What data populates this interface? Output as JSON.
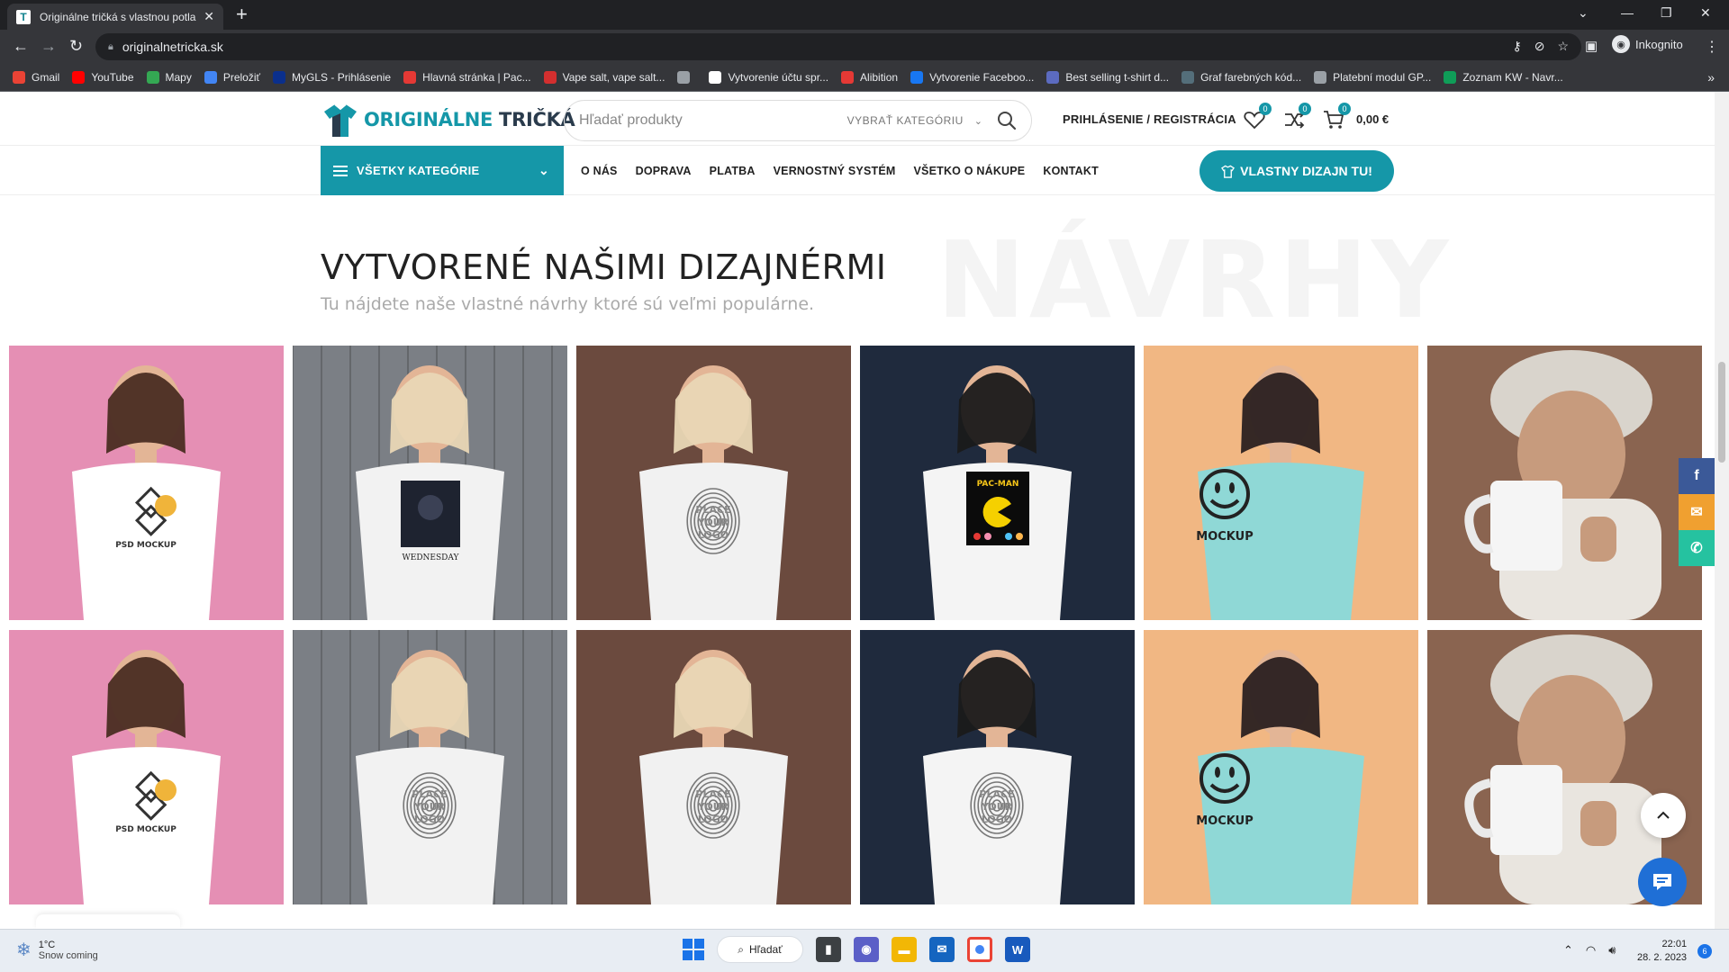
{
  "browser": {
    "tab_title": "Originálne tričká s vlastnou potla",
    "url": "originalnetricka.sk",
    "profile_label": "Inkognito",
    "bookmarks": [
      {
        "label": "Gmail",
        "color": "#ea4335"
      },
      {
        "label": "YouTube",
        "color": "#ff0000"
      },
      {
        "label": "Mapy",
        "color": "#34a853"
      },
      {
        "label": "Preložiť",
        "color": "#4285f4"
      },
      {
        "label": "MyGLS - Prihlásenie",
        "color": "#0a2f8c"
      },
      {
        "label": "Hlavná stránka | Pac...",
        "color": "#e53935"
      },
      {
        "label": "Vape salt, vape salt...",
        "color": "#d32f2f"
      },
      {
        "label": "",
        "color": "#9aa0a6"
      },
      {
        "label": "Vytvorenie účtu spr...",
        "color": "#ffffff"
      },
      {
        "label": "Alibition",
        "color": "#e53935"
      },
      {
        "label": "Vytvorenie Faceboo...",
        "color": "#1877f2"
      },
      {
        "label": "Best selling t-shirt d...",
        "color": "#5c6bc0"
      },
      {
        "label": "Graf farebných kód...",
        "color": "#546e7a"
      },
      {
        "label": "Platební modul GP...",
        "color": "#9aa0a6"
      },
      {
        "label": "Zoznam KW - Navr...",
        "color": "#0f9d58"
      }
    ]
  },
  "header": {
    "logo_part1": "ORIGINÁLNE",
    "logo_part2": "TRIČKÁ",
    "search_placeholder": "Hľadať produkty",
    "category_select": "VYBRAŤ KATEGÓRIU",
    "login": "PRIHLÁSENIE / REGISTRÁCIA",
    "wishlist_count": "0",
    "compare_count": "0",
    "cart_count": "0",
    "cart_total": "0,00 €"
  },
  "nav": {
    "all_categories": "VŠETKY KATEGÓRIE",
    "menu": [
      "O NÁS",
      "DOPRAVA",
      "PLATBA",
      "VERNOSTNÝ SYSTÉM",
      "VŠETKO O NÁKUPE",
      "KONTAKT"
    ],
    "cta": "VLASTNY DIZAJN TU!"
  },
  "section": {
    "watermark": "NÁVRHY",
    "title": "VYTVORENÉ NAŠIMI DIZAJNÉRMI",
    "subtitle": "Tu nájdete naše vlastné návrhy ktoré sú veľmi populárne."
  },
  "products": [
    {
      "bg": "#e58fb4",
      "shirt": "#ffffff",
      "print": "PSD MOCKUP",
      "kind": "logo"
    },
    {
      "bg": "#7b7f85",
      "shirt": "#f2f2f2",
      "print": "WEDNESDAY",
      "kind": "poster"
    },
    {
      "bg": "#6b4a3e",
      "shirt": "#f1f1f1",
      "print": "PLACE YOUR LOGO",
      "kind": "fingerprint"
    },
    {
      "bg": "#1f2a3d",
      "shirt": "#f4f4f4",
      "print": "PAC-MAN",
      "kind": "pacman"
    },
    {
      "bg": "#f1b783",
      "shirt": "#8fd8d6",
      "print": "MOCKUP",
      "kind": "smiley"
    },
    {
      "bg": "#8a6450",
      "shirt": "#e9e5df",
      "print": "",
      "kind": "mug"
    },
    {
      "bg": "#e58fb4",
      "shirt": "#ffffff",
      "print": "PSD MOCKUP",
      "kind": "logo"
    },
    {
      "bg": "#7b7f85",
      "shirt": "#f2f2f2",
      "print": "PLACE YOUR LOGO",
      "kind": "fingerprint"
    },
    {
      "bg": "#6b4a3e",
      "shirt": "#f1f1f1",
      "print": "PLACE YOUR LOGO",
      "kind": "fingerprint"
    },
    {
      "bg": "#1f2a3d",
      "shirt": "#f4f4f4",
      "print": "PLACE YOUR LOGO",
      "kind": "fingerprint"
    },
    {
      "bg": "#f1b783",
      "shirt": "#8fd8d6",
      "print": "MOCKUP",
      "kind": "smiley"
    },
    {
      "bg": "#8a6450",
      "shirt": "#e9e5df",
      "print": "",
      "kind": "mug"
    }
  ],
  "share": [
    {
      "name": "facebook-share-button",
      "glyph": "f",
      "color": "#3b5998"
    },
    {
      "name": "email-share-button",
      "glyph": "✉",
      "color": "#f0a030"
    },
    {
      "name": "whatsapp-share-button",
      "glyph": "✆",
      "color": "#25c2a0"
    }
  ],
  "taskbar": {
    "temp": "1°C",
    "weather": "Snow coming",
    "search": "Hľadať",
    "time": "22:01",
    "date": "28. 2. 2023",
    "notifications": "6"
  }
}
